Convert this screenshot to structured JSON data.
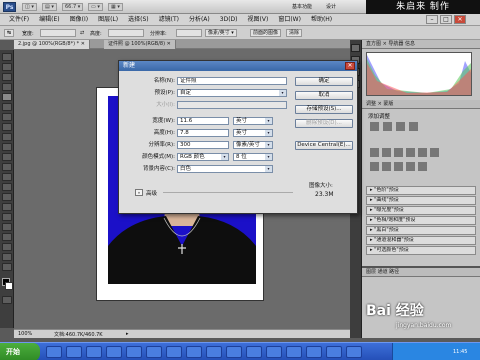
{
  "app": {
    "logo": "Ps",
    "watermark": "朱启来 制作"
  },
  "titlebar": {
    "mini": [
      "◫ ▾",
      "▤ ▾",
      "66.7 ▾",
      "▭ ▾",
      "▦ ▾"
    ],
    "workspace": "基本功能",
    "design": "设计"
  },
  "window_controls": {
    "minimize": "–",
    "maximize": "□",
    "close": "✕"
  },
  "menubar": {
    "items": [
      "文件(F)",
      "编辑(E)",
      "图像(I)",
      "图层(L)",
      "选择(S)",
      "滤镜(T)",
      "分析(A)",
      "3D(D)",
      "视图(V)",
      "窗口(W)",
      "帮助(H)"
    ]
  },
  "options": {
    "chips": [
      "↹",
      "宽度:",
      "⇄",
      "高度:",
      "分辨率:",
      "像素/英寸 ▾",
      "前面的图像",
      "清除"
    ]
  },
  "doc_tabs": [
    {
      "label": "2.jpg @ 100%(RGB/8*) *  ✕",
      "active": true
    },
    {
      "label": "证件照 @ 100%(RGB/8)  ✕",
      "active": false
    }
  ],
  "statusbar": {
    "zoom": "100%",
    "doc": "文档:460.7K/460.7K",
    "arrow": "▸"
  },
  "dialog": {
    "title": "新建",
    "close": "✕",
    "fields": {
      "name_label": "名称(N):",
      "name_value": "证件照",
      "preset_label": "预设(P):",
      "preset_value": "自定",
      "size_label": "大小(I):",
      "size_value": "",
      "width_label": "宽度(W):",
      "width_value": "11.6",
      "width_unit": "英寸",
      "height_label": "高度(H):",
      "height_value": "7.8",
      "height_unit": "英寸",
      "res_label": "分辨率(R):",
      "res_value": "300",
      "res_unit": "像素/英寸",
      "mode_label": "颜色模式(M):",
      "mode_value": "RGB 颜色",
      "mode_bits": "8 位",
      "bg_label": "背景内容(C):",
      "bg_value": "白色"
    },
    "advanced": "高级",
    "buttons": {
      "ok": "确定",
      "cancel": "取消",
      "save_preset": "存储预设(S)...",
      "delete_preset": "删除预设(D)...",
      "device_central": "Device Central(E)..."
    },
    "image_size_label": "图像大小:",
    "image_size_value": "23.3M"
  },
  "panels": {
    "histogram_tabs": "直方图 ×  导航器  信息",
    "adjust_tabs": "调整 ×  蒙版",
    "adjust_heading": "添加调整",
    "presets": [
      "▸ \"色阶\"预设",
      "▸ \"曲线\"预设",
      "▸ \"曝光度\"预设",
      "▸ \"色相/饱和度\"预设",
      "▸ \"黑白\"预设",
      "▸ \"通道混和器\"预设",
      "▸ \"可选颜色\"预设"
    ],
    "layers_tabs": "图层  通道  路径"
  },
  "taskbar": {
    "start": "开始",
    "clock": "11:45",
    "site": "jingyan.baidu.com"
  },
  "baidu": {
    "logo": "Bai 经验"
  }
}
